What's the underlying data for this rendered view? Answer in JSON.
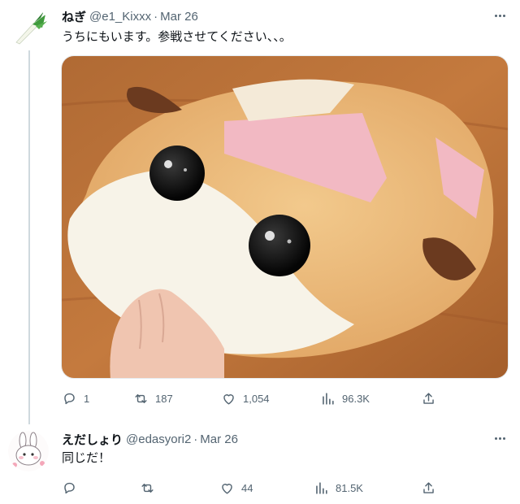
{
  "tweets": [
    {
      "avatar_icon": "leek-avatar-icon",
      "name": "ねぎ",
      "handle": "@e1_Kixxx",
      "separator": "·",
      "date": "Mar 26",
      "text": "うちにもいます。参戦させてください、、。",
      "stats": {
        "replies": "1",
        "retweets": "187",
        "likes": "1,054",
        "views": "96.3K"
      }
    },
    {
      "avatar_icon": "bunny-avatar-icon",
      "name": "えだしょり",
      "handle": "@edasyori2",
      "separator": "·",
      "date": "Mar 26",
      "text": "同じだ！",
      "stats": {
        "replies": "",
        "retweets": "",
        "likes": "44",
        "views": "81.5K"
      }
    }
  ],
  "colors": {
    "text_primary": "#0f1419",
    "text_secondary": "#536471",
    "thread_line": "#cfd9de"
  }
}
